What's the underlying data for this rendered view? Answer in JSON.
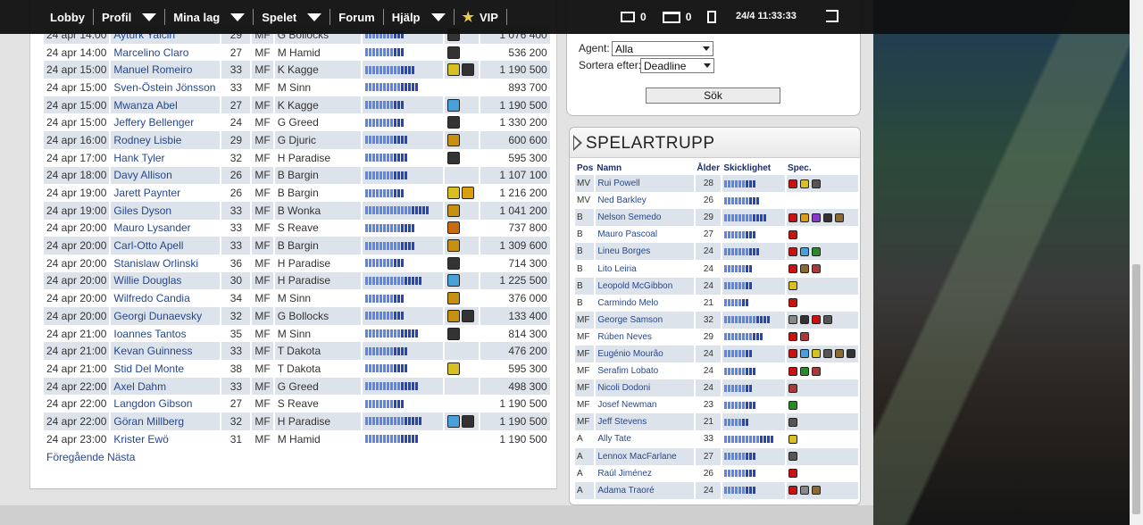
{
  "nav": {
    "lobby": "Lobby",
    "profil": "Profil",
    "mina_lag": "Mina lag",
    "spelet": "Spelet",
    "forum": "Forum",
    "hjalp": "Hjälp",
    "vip": "VIP",
    "mail_count": "0",
    "news_count": "0",
    "datetime": "24/4 11:33:33"
  },
  "colors": {
    "accent": "#27478c",
    "bar_light": "#5a86e8",
    "bar_dark": "#2447b8",
    "row_alt": "#dde3ea"
  },
  "market": {
    "rows": [
      {
        "date": "24 apr 14:00",
        "name": "Ayturk Yalcin",
        "age": "29",
        "pos": "MF",
        "team": "G Bollocks",
        "skill": 0.55,
        "specs": [
          "#333"
        ],
        "price": "1 076 400"
      },
      {
        "date": "24 apr 14:00",
        "name": "Marcelino Claro",
        "age": "27",
        "pos": "MF",
        "team": "M Hamid",
        "skill": 0.55,
        "specs": [
          "#333"
        ],
        "price": "536 200"
      },
      {
        "date": "24 apr 15:00",
        "name": "Manuel Romeiro",
        "age": "33",
        "pos": "MF",
        "team": "K Kagge",
        "skill": 0.68,
        "specs": [
          "#d8c020",
          "#333"
        ],
        "price": "1 190 500"
      },
      {
        "date": "24 apr 15:00",
        "name": "Sven-Östein Jönsson",
        "age": "33",
        "pos": "MF",
        "team": "M Sinn",
        "skill": 0.75,
        "specs": [],
        "price": "893 700"
      },
      {
        "date": "24 apr 15:00",
        "name": "Mwanza Abel",
        "age": "27",
        "pos": "MF",
        "team": "K Kagge",
        "skill": 0.55,
        "specs": [
          "#4aa0d8"
        ],
        "price": "1 190 500"
      },
      {
        "date": "24 apr 15:00",
        "name": "Jeffery Bellenger",
        "age": "24",
        "pos": "MF",
        "team": "G Greed",
        "skill": 0.55,
        "specs": [
          "#333"
        ],
        "price": "1 330 200"
      },
      {
        "date": "24 apr 16:00",
        "name": "Rodney Lisbie",
        "age": "29",
        "pos": "MF",
        "team": "G Djuric",
        "skill": 0.62,
        "specs": [
          "#c89010"
        ],
        "price": "600 600"
      },
      {
        "date": "24 apr 17:00",
        "name": "Hank Tyler",
        "age": "32",
        "pos": "MF",
        "team": "H Paradise",
        "skill": 0.62,
        "specs": [
          "#333"
        ],
        "price": "595 300"
      },
      {
        "date": "24 apr 18:00",
        "name": "Davy Allison",
        "age": "26",
        "pos": "MF",
        "team": "B Bargin",
        "skill": 0.62,
        "specs": [],
        "price": "1 107 100"
      },
      {
        "date": "24 apr 19:00",
        "name": "Jarett Paynter",
        "age": "26",
        "pos": "MF",
        "team": "B Bargin",
        "skill": 0.55,
        "specs": [
          "#d8c020",
          "#d8a010"
        ],
        "price": "1 216 200"
      },
      {
        "date": "24 apr 19:00",
        "name": "Giles Dyson",
        "age": "33",
        "pos": "MF",
        "team": "B Wonka",
        "skill": 0.88,
        "specs": [
          "#c89010"
        ],
        "price": "1 041 200"
      },
      {
        "date": "24 apr 20:00",
        "name": "Mauro Lysander",
        "age": "33",
        "pos": "MF",
        "team": "S Reave",
        "skill": 0.68,
        "specs": [
          "#c86a10"
        ],
        "price": "737 800"
      },
      {
        "date": "24 apr 20:00",
        "name": "Carl-Otto Apell",
        "age": "33",
        "pos": "MF",
        "team": "B Bargin",
        "skill": 0.68,
        "specs": [
          "#c89010"
        ],
        "price": "1 309 600"
      },
      {
        "date": "24 apr 20:00",
        "name": "Stanislaw Orlinski",
        "age": "36",
        "pos": "MF",
        "team": "H Paradise",
        "skill": 0.55,
        "specs": [
          "#333"
        ],
        "price": "714 300"
      },
      {
        "date": "24 apr 20:00",
        "name": "Willie Douglas",
        "age": "30",
        "pos": "MF",
        "team": "H Paradise",
        "skill": 0.82,
        "specs": [
          "#4aa0d8"
        ],
        "price": "1 225 500"
      },
      {
        "date": "24 apr 20:00",
        "name": "Wilfredo Candia",
        "age": "34",
        "pos": "MF",
        "team": "M Sinn",
        "skill": 0.55,
        "specs": [
          "#c89010"
        ],
        "price": "376 000"
      },
      {
        "date": "24 apr 20:00",
        "name": "Georgi Dunaevsky",
        "age": "32",
        "pos": "MF",
        "team": "G Bollocks",
        "skill": 0.55,
        "specs": [
          "#c89010",
          "#333"
        ],
        "price": "133 400"
      },
      {
        "date": "24 apr 21:00",
        "name": "Ioannes Tantos",
        "age": "35",
        "pos": "MF",
        "team": "M Sinn",
        "skill": 0.75,
        "specs": [
          "#333"
        ],
        "price": "814 300"
      },
      {
        "date": "24 apr 21:00",
        "name": "Kevan Guinness",
        "age": "33",
        "pos": "MF",
        "team": "T Dakota",
        "skill": 0.62,
        "specs": [],
        "price": "476 200"
      },
      {
        "date": "24 apr 21:00",
        "name": "Stid Del Monte",
        "age": "38",
        "pos": "MF",
        "team": "T Dakota",
        "skill": 0.62,
        "specs": [
          "#d8c020"
        ],
        "price": "595 300"
      },
      {
        "date": "24 apr 22:00",
        "name": "Axel Dahm",
        "age": "33",
        "pos": "MF",
        "team": "G Greed",
        "skill": 0.75,
        "specs": [],
        "price": "498 300"
      },
      {
        "date": "24 apr 22:00",
        "name": "Langdon Gibson",
        "age": "27",
        "pos": "MF",
        "team": "S Reave",
        "skill": 0.55,
        "specs": [],
        "price": "1 190 500"
      },
      {
        "date": "24 apr 22:00",
        "name": "Göran Millberg",
        "age": "32",
        "pos": "MF",
        "team": "H Paradise",
        "skill": 0.82,
        "specs": [
          "#4aa0d8",
          "#333"
        ],
        "price": "1 190 500"
      },
      {
        "date": "24 apr 23:00",
        "name": "Krister Ewö",
        "age": "31",
        "pos": "MF",
        "team": "M Hamid",
        "skill": 0.75,
        "specs": [],
        "price": "1 190 500"
      }
    ]
  },
  "pager": {
    "prev": "Föregående",
    "next": "Nästa"
  },
  "search": {
    "agent_label": "Agent:",
    "agent_value": "Alla",
    "sort_label": "Sortera efter:",
    "sort_value": "Deadline",
    "search_button": "Sök"
  },
  "squad": {
    "title": "SPELARTRUPP",
    "headers": {
      "pos": "Pos",
      "name": "Namn",
      "age": "Ålder",
      "skill": "Skicklighet",
      "spec": "Spec."
    },
    "rows": [
      {
        "pos": "MV",
        "name": "Rui Powell",
        "age": "28",
        "skill": 0.6,
        "specs": [
          "#cc1111",
          "#d8c020",
          "#555"
        ]
      },
      {
        "pos": "MV",
        "name": "Ned Barkley",
        "age": "26",
        "skill": 0.67,
        "specs": []
      },
      {
        "pos": "B",
        "name": "Nelson Semedo",
        "age": "29",
        "skill": 0.8,
        "specs": [
          "#cc1111",
          "#d8a010",
          "#8a3ac8",
          "#333",
          "#8a6a30"
        ]
      },
      {
        "pos": "B",
        "name": "Mauro Pascoal",
        "age": "27",
        "skill": 0.6,
        "specs": [
          "#cc1111"
        ]
      },
      {
        "pos": "B",
        "name": "Lineu Borges",
        "age": "24",
        "skill": 0.67,
        "specs": [
          "#cc1111",
          "#4aa0d8",
          "#2a8a2a"
        ]
      },
      {
        "pos": "B",
        "name": "Lito Leiria",
        "age": "24",
        "skill": 0.53,
        "specs": [
          "#cc1111",
          "#8a6a30",
          "#aa3a3a"
        ]
      },
      {
        "pos": "B",
        "name": "Leopold McGibbon",
        "age": "24",
        "skill": 0.53,
        "specs": [
          "#d8c020"
        ]
      },
      {
        "pos": "B",
        "name": "Carmindo Melo",
        "age": "21",
        "skill": 0.47,
        "specs": [
          "#cc1111"
        ]
      },
      {
        "pos": "MF",
        "name": "George Samson",
        "age": "32",
        "skill": 0.87,
        "specs": [
          "#888",
          "#333",
          "#cc1111",
          "#555"
        ]
      },
      {
        "pos": "MF",
        "name": "Rúben Neves",
        "age": "29",
        "skill": 0.73,
        "specs": [
          "#cc1111",
          "#aa3a3a"
        ]
      },
      {
        "pos": "MF",
        "name": "Eugénio Mourão",
        "age": "24",
        "skill": 0.53,
        "specs": [
          "#cc1111",
          "#4aa0d8",
          "#d8c020",
          "#555",
          "#8a6a30",
          "#333"
        ]
      },
      {
        "pos": "MF",
        "name": "Serafim Lobato",
        "age": "24",
        "skill": 0.6,
        "specs": [
          "#cc1111",
          "#2a8a2a",
          "#aa3a3a"
        ]
      },
      {
        "pos": "MF",
        "name": "Nicoli Dodoni",
        "age": "24",
        "skill": 0.53,
        "specs": [
          "#aa3a3a"
        ]
      },
      {
        "pos": "MF",
        "name": "Josef Newman",
        "age": "23",
        "skill": 0.6,
        "specs": [
          "#2a8a2a"
        ]
      },
      {
        "pos": "MF",
        "name": "Jeff Stevens",
        "age": "21",
        "skill": 0.47,
        "specs": [
          "#555"
        ]
      },
      {
        "pos": "A",
        "name": "Ally Tate",
        "age": "33",
        "skill": 0.93,
        "specs": [
          "#d8c020"
        ]
      },
      {
        "pos": "A",
        "name": "Lennox MacFarlane",
        "age": "27",
        "skill": 0.6,
        "specs": [
          "#555"
        ]
      },
      {
        "pos": "A",
        "name": "Raúl Jiménez",
        "age": "26",
        "skill": 0.6,
        "specs": [
          "#cc1111"
        ]
      },
      {
        "pos": "A",
        "name": "Adama Traoré",
        "age": "24",
        "skill": 0.6,
        "specs": [
          "#cc1111",
          "#888",
          "#8a6a30"
        ]
      }
    ]
  }
}
